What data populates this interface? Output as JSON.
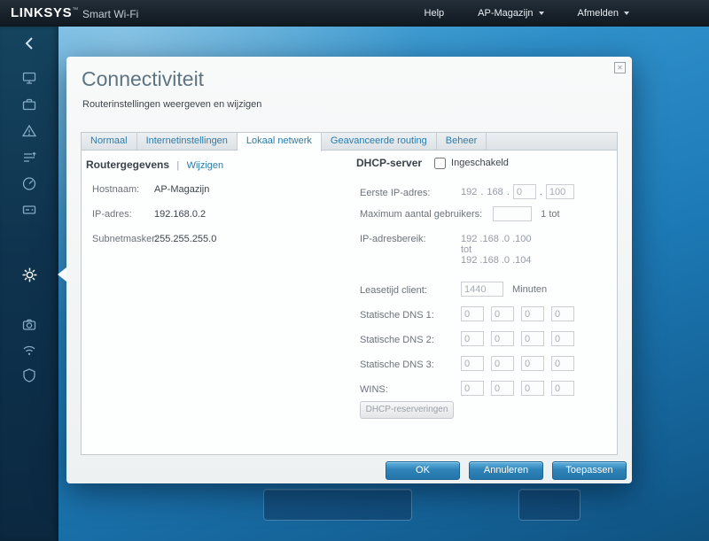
{
  "colors": {
    "accent_blue": "#2d7cab",
    "button_blue": "#2e83b8",
    "background_blue": "#1d7ab6",
    "sidebar_navy": "#0f334e",
    "topbar_dark": "#141c24"
  },
  "topbar": {
    "brand": "LINKSYS",
    "trademark": "™",
    "product": "Smart Wi-Fi",
    "menu": [
      {
        "label": "Help"
      },
      {
        "label": "AP-Magazijn"
      },
      {
        "label": "Afmelden"
      }
    ]
  },
  "sidebar": {
    "items": [
      {
        "name": "back"
      },
      {
        "name": "network-map"
      },
      {
        "name": "guest-access"
      },
      {
        "name": "parental-controls"
      },
      {
        "name": "media-prioritization"
      },
      {
        "name": "speed-test"
      },
      {
        "name": "external-storage"
      },
      {
        "name": "connectivity",
        "selected": true
      },
      {
        "name": "troubleshooting"
      },
      {
        "name": "wireless"
      },
      {
        "name": "security"
      }
    ]
  },
  "dialog": {
    "title": "Connectiviteit",
    "subtitle": "Routerinstellingen weergeven en wijzigen",
    "close_glyph": "✕",
    "tabs": [
      {
        "label": "Normaal",
        "active": false
      },
      {
        "label": "Internetinstellingen",
        "active": false
      },
      {
        "label": "Lokaal netwerk",
        "active": true
      },
      {
        "label": "Geavanceerde routing",
        "active": false
      },
      {
        "label": "Beheer",
        "active": false
      }
    ],
    "router_info": {
      "heading": "Routergegevens",
      "divider": "|",
      "edit_link": "Wijzigen",
      "rows": [
        {
          "label": "Hostnaam:",
          "value": "AP-Magazijn"
        },
        {
          "label": "IP-adres:",
          "value": "192.168.0.2"
        },
        {
          "label": "Subnetmasker:",
          "value": "255.255.255.0"
        }
      ]
    },
    "dhcp": {
      "heading": "DHCP-server",
      "enabled_label": "Ingeschakeld",
      "enabled_checked": false,
      "dot": ".",
      "first_ip": {
        "label": "Eerste IP-adres:",
        "octet1": "192",
        "octet2": "168",
        "octet3": "0",
        "octet4": "100"
      },
      "max_users": {
        "label": "Maximum aantal gebruikers:",
        "value": "",
        "suffix": "1 tot"
      },
      "ip_range": {
        "label": "IP-adresbereik:",
        "start": "192 .168 .0 .100",
        "connector": "tot",
        "end": "192 .168 .0 .104"
      },
      "lease": {
        "label": "Leasetijd client:",
        "value": "1440",
        "suffix": "Minuten"
      },
      "dns": [
        {
          "label": "Statische DNS 1:",
          "v1": "0",
          "v2": "0",
          "v3": "0",
          "v4": "0"
        },
        {
          "label": "Statische DNS 2:",
          "v1": "0",
          "v2": "0",
          "v3": "0",
          "v4": "0"
        },
        {
          "label": "Statische DNS 3:",
          "v1": "0",
          "v2": "0",
          "v3": "0",
          "v4": "0"
        },
        {
          "label": "WINS:",
          "v1": "0",
          "v2": "0",
          "v3": "0",
          "v4": "0"
        }
      ],
      "reservations_button": "DHCP-reserveringen"
    },
    "footer": {
      "ok": "OK",
      "cancel": "Annuleren",
      "apply": "Toepassen"
    }
  }
}
